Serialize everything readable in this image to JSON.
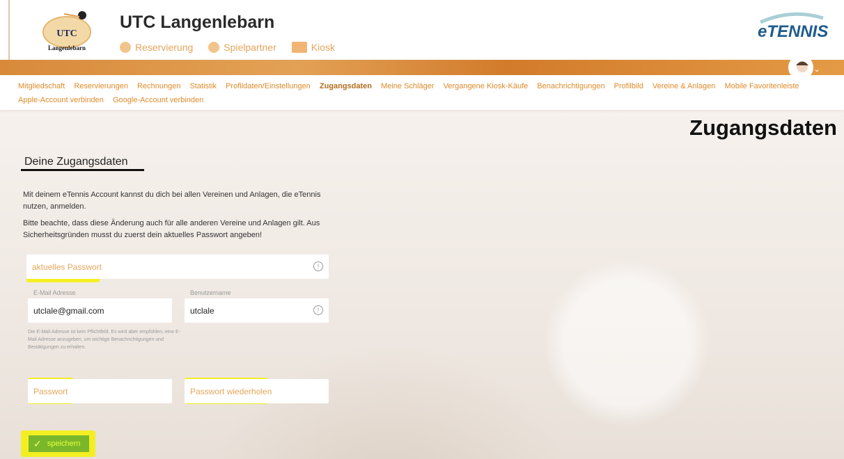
{
  "header": {
    "club_name": "UTC Langenlebarn",
    "logo_text_top": "UTC",
    "logo_text_bottom": "Langenlebarn",
    "brand": "eTENNIS",
    "nav": [
      {
        "label": "Reservierung",
        "icon": "clock-icon"
      },
      {
        "label": "Spielpartner",
        "icon": "handshake-icon"
      },
      {
        "label": "Kiosk",
        "icon": "kiosk-icon"
      }
    ]
  },
  "submenu": [
    "Mitgliedschaft",
    "Reservierungen",
    "Rechnungen",
    "Statistik",
    "Profildaten/Einstellungen",
    "Zugangsdaten",
    "Meine Schläger",
    "Vergangene Kiosk-Käufe",
    "Benachrichtigungen",
    "Profilbild",
    "Vereine & Anlagen",
    "Mobile Favoritenleiste",
    "Apple-Account verbinden",
    "Google-Account verbinden"
  ],
  "page": {
    "heading": "Zugangsdaten",
    "section_title": "Deine Zugangsdaten",
    "para1": "Mit deinem eTennis Account kannst du dich bei allen Vereinen und Anlagen, die eTennis nutzen, anmelden.",
    "para2": "Bitte beachte, dass diese Änderung auch für alle anderen Vereine und Anlagen gilt. Aus Sicherheitsgründen musst du zuerst dein aktuelles Passwort angeben!"
  },
  "form": {
    "current_password_placeholder": "aktuelles Passwort",
    "email_label": "E-Mail Adresse",
    "email_value": "utclale@gmail.com",
    "username_label": "Benutzername",
    "username_value": "utclale",
    "email_hint": "Die E-Mail Adresse ist kein Pflichtfeld. Es wird aber empfohlen, eine E-Mail Adresse anzugeben, um wichtige Benachrichtigungen und Bestätigungen zu erhalten.",
    "password_placeholder": "Passwort",
    "password_repeat_placeholder": "Passwort wiederholen",
    "save_label": "speichern"
  },
  "colors": {
    "accent": "#de8a2a",
    "highlight": "#f5f000",
    "save": "#7bb72a"
  }
}
